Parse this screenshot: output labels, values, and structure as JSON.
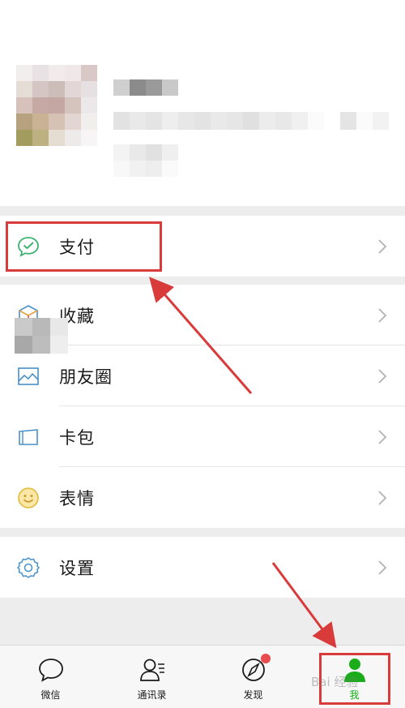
{
  "profile": {
    "name_blurred": true,
    "wechat_id_blurred": true
  },
  "menu": {
    "pay": {
      "label": "支付",
      "icon": "wechat-pay-icon"
    },
    "items": [
      {
        "label": "收藏",
        "icon": "favorites-cube-icon"
      },
      {
        "label": "朋友圈",
        "icon": "moments-photo-icon"
      },
      {
        "label": "卡包",
        "icon": "card-wallet-icon"
      },
      {
        "label": "表情",
        "icon": "sticker-smiley-icon"
      }
    ],
    "settings": {
      "label": "设置",
      "icon": "gear-icon"
    }
  },
  "tabbar": {
    "tabs": [
      {
        "label": "微信",
        "icon": "chat-bubble-icon",
        "active": false
      },
      {
        "label": "通讯录",
        "icon": "contacts-icon",
        "active": false
      },
      {
        "label": "发现",
        "icon": "compass-icon",
        "active": false,
        "badge_dot": true
      },
      {
        "label": "我",
        "icon": "me-person-icon",
        "active": true
      }
    ]
  },
  "annotation": {
    "watermark": "Bai 经验",
    "highlight_color": "#d93a3a"
  },
  "colors": {
    "wechat_green": "#1aad19",
    "background": "#ededed",
    "badge_red": "#e84c4c"
  }
}
